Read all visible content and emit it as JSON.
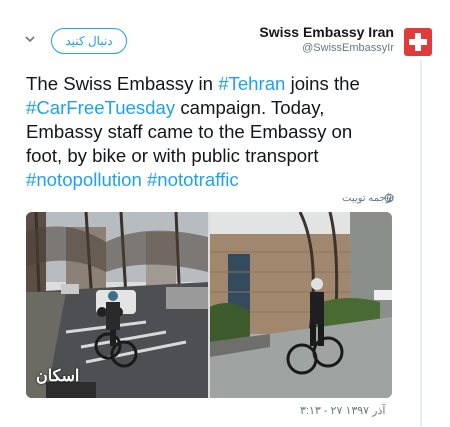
{
  "header": {
    "follow_label": "دنبال کنید",
    "display_name": "Swiss Embassy Iran",
    "handle": "@SwissEmbassyIr"
  },
  "tweet": {
    "lines": [
      [
        {
          "t": "The Swiss Embassy in ",
          "tag": false
        },
        {
          "t": "#Tehran",
          "tag": true
        },
        {
          "t": " joins the",
          "tag": false
        }
      ],
      [
        {
          "t": "#CarFreeTuesday",
          "tag": true
        },
        {
          "t": " campaign. Today,",
          "tag": false
        }
      ],
      [
        {
          "t": "Embassy staff came to the Embassy on",
          "tag": false
        }
      ],
      [
        {
          "t": "foot, by bike or with public transport",
          "tag": false
        }
      ],
      [
        {
          "t": "#notopollution",
          "tag": true
        },
        {
          "t": " ",
          "tag": false
        },
        {
          "t": "#nototraffic",
          "tag": true
        }
      ]
    ],
    "translate_label": "ترجمه توییت",
    "timestamp": "۳:۱۳ - ۲۷ آذر ۱۳۹۷",
    "watermark": "اسکان"
  },
  "colors": {
    "accent": "#1da1f2",
    "brand_red": "#e03a3a",
    "muted": "#657786"
  },
  "icons": {
    "avatar": "swiss-cross-icon",
    "menu": "chevron-down-icon",
    "translate": "globe-icon"
  }
}
